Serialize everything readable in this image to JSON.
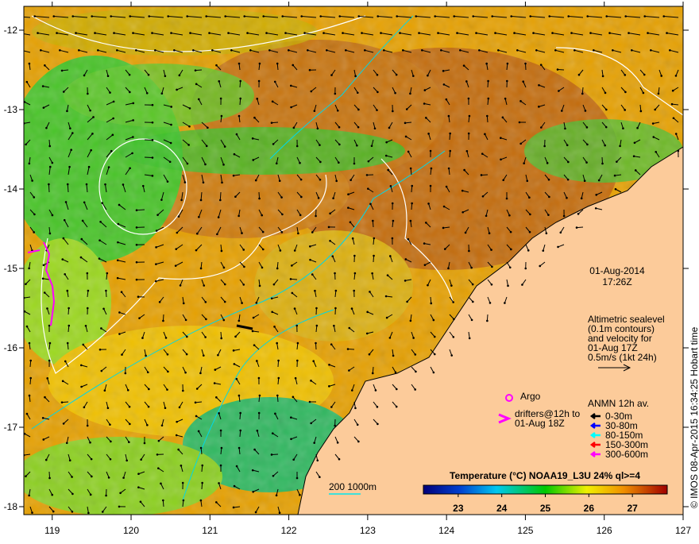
{
  "map": {
    "lon_ticks": [
      "119",
      "120",
      "121",
      "122",
      "123",
      "124",
      "125",
      "126",
      "127"
    ],
    "lat_ticks": [
      "-12",
      "-13",
      "-14",
      "-15",
      "-16",
      "-17",
      "-18"
    ],
    "lon_range": [
      118.64,
      127
    ],
    "lat_range": [
      -18.1,
      -11.7
    ]
  },
  "annotations": {
    "date": "01-Aug-2014",
    "time": "17:26Z",
    "altimetry": [
      "Altimetric sealevel",
      "(0.1m contours)",
      "and velocity for",
      "01-Aug 17Z",
      "0.5m/s (1kt 24h)"
    ],
    "argo": "Argo",
    "drifters": [
      "drifters@12h to",
      "01-Aug 18Z"
    ],
    "anmn_title": "ANMN 12h av.",
    "anmn_items": [
      {
        "label": "0-30m",
        "color": "#000000"
      },
      {
        "label": "30-80m",
        "color": "#0000ff"
      },
      {
        "label": "80-150m",
        "color": "#00ffff"
      },
      {
        "label": "150-300m",
        "color": "#ff0000"
      },
      {
        "label": "300-600m",
        "color": "#ff00ff"
      }
    ],
    "depth_scale": "200  1000m",
    "credit": "© IMOS 08-Apr-2015 16:34:25 Hobart time"
  },
  "colorbar": {
    "title": "Temperature (°C) NOAA19_L3U 24% ql>=4",
    "ticks": [
      "23",
      "24",
      "25",
      "26",
      "27"
    ],
    "range": [
      22.2,
      27.8
    ]
  },
  "colors": {
    "land": "#fccb9a",
    "ocean_warm": "#c8700a",
    "ocean_mid": "#e8a400",
    "ocean_cool": "#3cc020",
    "contour": "#ffffff",
    "isobath": "#00d8e8"
  }
}
